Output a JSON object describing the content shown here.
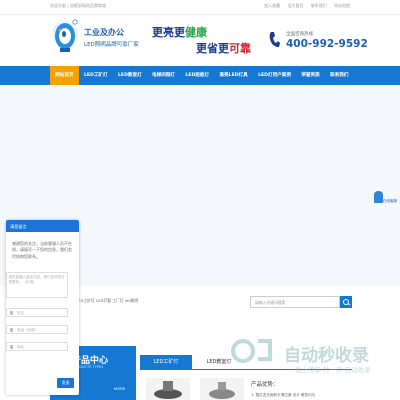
{
  "topbar": {
    "left": "欢迎光临 | 加载采购网品牌商城",
    "links": [
      "加入收藏",
      "设为首页",
      "联系我们",
      "网站地图"
    ]
  },
  "header": {
    "brand_name": "工业及办公",
    "brand_sub": "LED照明品牌可靠厂家",
    "slogan1_a": "更亮",
    "slogan1_b": "更",
    "slogan1_c": "健康",
    "slogan2_a": "更省",
    "slogan2_b": "更",
    "slogan2_c": "可靠",
    "hotline_label": "全国咨询热线",
    "hotline": "400-992-9592"
  },
  "nav": {
    "items": [
      {
        "label": "网站首页",
        "active": true
      },
      {
        "label": "LED工矿灯"
      },
      {
        "label": "LED教室灯"
      },
      {
        "label": "电梯间照灯"
      },
      {
        "label": "LED面板灯"
      },
      {
        "label": "高亮LED灯具"
      },
      {
        "label": "LED灯用户案例"
      },
      {
        "label": "荣誉资质"
      },
      {
        "label": "联系我们"
      }
    ]
  },
  "float_service": {
    "label": "在线客服"
  },
  "chat": {
    "title": "请您留言",
    "message": "感谢您的关注，当前客服人员不在线，请填写一下您的信息，我们会尽快和您联系。",
    "textarea_placeholder": "请在此输入留言内容，我们会尽快与您联系。（必填）",
    "fields": [
      "姓名",
      "电话（必填）",
      "地址"
    ],
    "send_label": "发送"
  },
  "breadcrumb": "LED工矿灯  LED灯管  工厂灯  led照明",
  "search": {
    "placeholder": "请输入关键词搜索"
  },
  "category": {
    "title": "产品中心",
    "subtitle": "PRODUCTS TYPES",
    "more": "MORE"
  },
  "tabs": [
    "LED工矿灯",
    "LED教室灯"
  ],
  "product": {
    "features_title": "产品优势：",
    "feature_1": "1. 整灯发光面积平滑过渡 设计 散热均匀"
  },
  "watermark": {
    "main": "自动秒收录",
    "sub": "做上榜单  秒一次  自动收录"
  },
  "colors": {
    "brand_blue": "#1578d3",
    "accent_orange": "#f5a200"
  }
}
